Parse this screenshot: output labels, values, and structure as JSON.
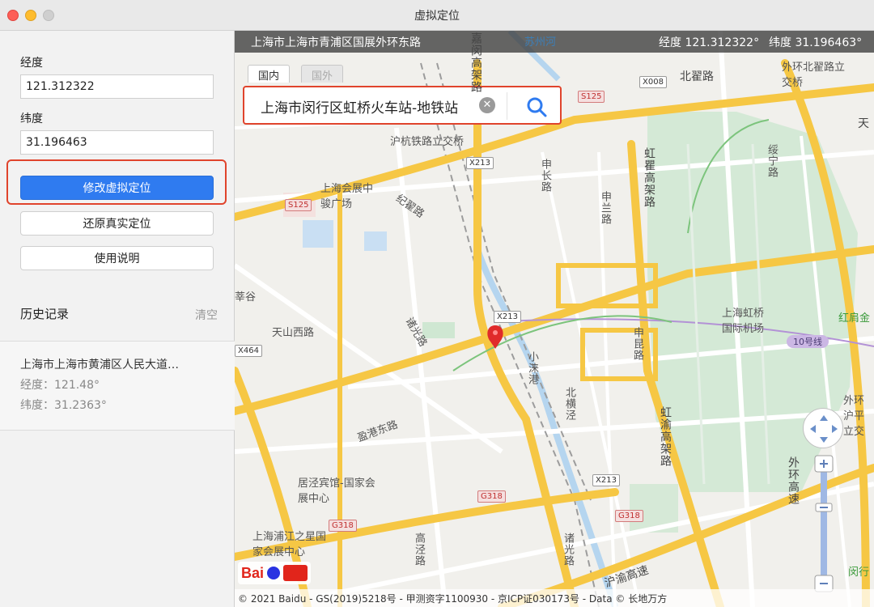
{
  "window": {
    "title": "虚拟定位"
  },
  "panel": {
    "longitude_label": "经度",
    "longitude_value": "121.312322",
    "latitude_label": "纬度",
    "latitude_value": "31.196463",
    "modify_button": "修改虚拟定位",
    "restore_button": "还原真实定位",
    "help_button": "使用说明",
    "history_title": "历史记录",
    "clear_label": "清空",
    "history": [
      {
        "address": "上海市上海市黄浦区人民大道…",
        "longitude": "经度：121.48°",
        "latitude": "纬度：31.2363°"
      }
    ]
  },
  "map": {
    "address_bar": "上海市上海市青浦区国展外环东路",
    "lng_readout": "经度 121.312322°",
    "lat_readout": "纬度 31.196463°",
    "tabs": [
      {
        "label": "国内",
        "active": true
      },
      {
        "label": "国外",
        "active": false
      }
    ],
    "search_text": "上海市闵行区虹桥火车站-地铁站",
    "search_icon": "search-icon",
    "copyright": "© 2021 Baidu - GS(2019)5218号 - 甲测资字1100930 - 京ICP证030173号 - Data © 长地万方",
    "logo": "Baidu地图",
    "labels": {
      "jiamin": "嘉闵高架路",
      "suzhouhe": "苏州河",
      "beizhai": "北翟路",
      "waihuan_beizhai": "外环北翟路立交桥",
      "tian": "天",
      "huhang": "沪杭铁路立交桥",
      "shenchang": "申长路",
      "hongqu": "虹瞿高架路",
      "suining": "绥宁路",
      "shanghai_huizhan": "上海会展中骏广场",
      "jizhai": "纪翟路",
      "shenlan": "申兰路",
      "pugu": "莘谷",
      "tianshan": "天山西路",
      "zhuguang": "诸光路",
      "xiaoyong": "小涞港",
      "hongqiao_airport": "上海虹桥国际机场",
      "hongjian": "红肩金",
      "line10": "10号线",
      "shenkun": "申昆路",
      "beiheng": "北横泾",
      "hongyu": "虹渝高架路",
      "waihuan_ping": "外环沪平立交",
      "yinggang": "盈港东路",
      "juying": "居泾宾馆-国家会展中心",
      "huyu": "沪渝高速",
      "pujiang": "上海浦江之星国家会展中心",
      "gaojing": "高泾路",
      "zhuguang2": "诸光路",
      "waihuan": "外环高速",
      "minxing": "闵行"
    },
    "shields": {
      "x008": "X008",
      "s125a": "S125",
      "s125b": "S125",
      "x213a": "X213",
      "x213b": "X213",
      "x213c": "X213",
      "g318a": "G318",
      "g318b": "G318",
      "g318c": "G318",
      "x464": "X464"
    },
    "colors": {
      "highway": "#f6c744",
      "road": "#ffffff",
      "water": "#b5d5ef",
      "green": "#cfe7d2",
      "marker": "#e02a2a"
    }
  }
}
